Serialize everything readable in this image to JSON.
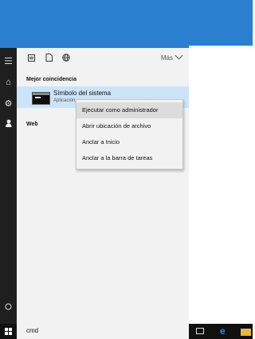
{
  "start_panel": {
    "more_label": "Más",
    "best_match_header": "Mejor coincidencia",
    "result": {
      "title": "Símbolo del sistema",
      "subtitle": "Aplicación"
    },
    "web_header": "Web"
  },
  "context_menu": {
    "items": [
      "Ejecutar como administrador",
      "Abrir ubicación de archivo",
      "Anclar a Inicio",
      "Anclar a la barra de tareas"
    ]
  },
  "taskbar": {
    "search_value": "cmd"
  },
  "colors": {
    "accent_blue": "#2a7fce",
    "selection": "#cce4f7",
    "taskbar": "#101010",
    "edge": "#2a8ae0",
    "explorer": "#e8b83a"
  },
  "icons": {
    "left_rail": [
      "hamburger-icon",
      "home-icon",
      "settings-icon",
      "user-icon",
      "power-icon"
    ],
    "top_filters": [
      "apps-icon",
      "documents-icon",
      "web-icon"
    ],
    "taskbar": [
      "windows-icon",
      "task-view-icon",
      "edge-icon",
      "file-explorer-icon"
    ]
  }
}
